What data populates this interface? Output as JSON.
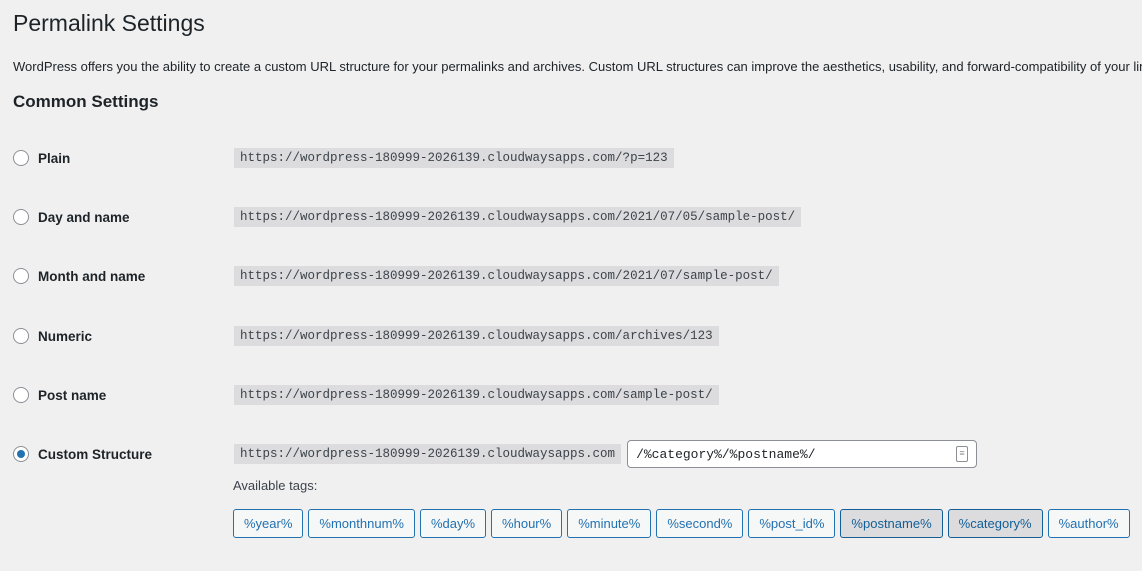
{
  "title": "Permalink Settings",
  "description": "WordPress offers you the ability to create a custom URL structure for your permalinks and archives. Custom URL structures can improve the aesthetics, usability, and forward-compatibility of your links.",
  "section": "Common Settings",
  "options": [
    {
      "label": "Plain",
      "example": "https://wordpress-180999-2026139.cloudwaysapps.com/?p=123",
      "selected": false
    },
    {
      "label": "Day and name",
      "example": "https://wordpress-180999-2026139.cloudwaysapps.com/2021/07/05/sample-post/",
      "selected": false
    },
    {
      "label": "Month and name",
      "example": "https://wordpress-180999-2026139.cloudwaysapps.com/2021/07/sample-post/",
      "selected": false
    },
    {
      "label": "Numeric",
      "example": "https://wordpress-180999-2026139.cloudwaysapps.com/archives/123",
      "selected": false
    },
    {
      "label": "Post name",
      "example": "https://wordpress-180999-2026139.cloudwaysapps.com/sample-post/",
      "selected": false
    },
    {
      "label": "Custom Structure",
      "example": "https://wordpress-180999-2026139.cloudwaysapps.com",
      "selected": true
    }
  ],
  "custom_value": "/%category%/%postname%/",
  "available_tags_label": "Available tags:",
  "tags": [
    {
      "label": "%year%",
      "active": false
    },
    {
      "label": "%monthnum%",
      "active": false
    },
    {
      "label": "%day%",
      "active": false
    },
    {
      "label": "%hour%",
      "active": false
    },
    {
      "label": "%minute%",
      "active": false
    },
    {
      "label": "%second%",
      "active": false
    },
    {
      "label": "%post_id%",
      "active": false
    },
    {
      "label": "%postname%",
      "active": true
    },
    {
      "label": "%category%",
      "active": true
    },
    {
      "label": "%author%",
      "active": false
    }
  ],
  "accent": "#2271b1"
}
